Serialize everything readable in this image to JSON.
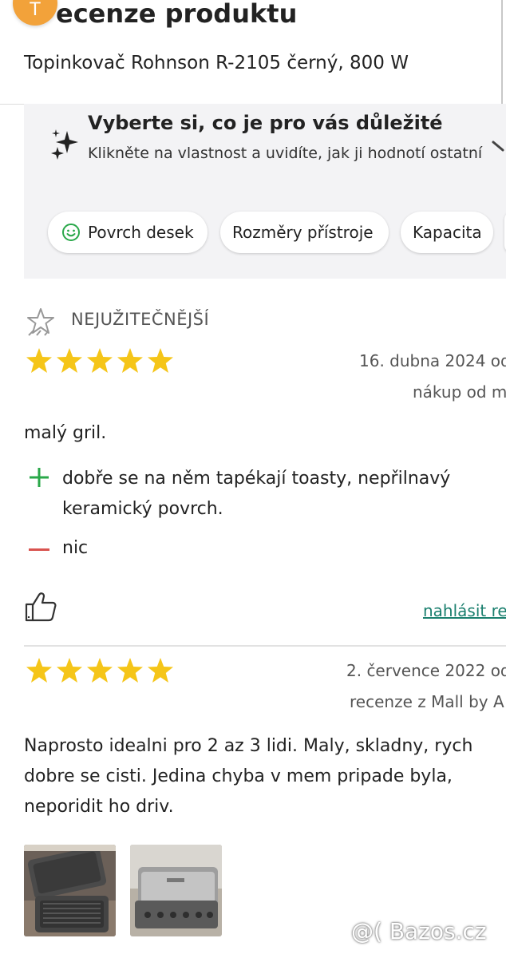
{
  "header": {
    "avatar_initial": "T",
    "title": "ecenze produktu",
    "product": "Topinkovač Rohnson R-2105 černý, 800 W"
  },
  "preferences": {
    "title": "Vyberte si, co je pro vás důležité",
    "description": "Klikněte na vlastnost a uvidíte, jak ji hodnotí ostatní",
    "chips": [
      "Povrch desek",
      "Rozměry přístroje",
      "Kapacita"
    ]
  },
  "reviews": [
    {
      "badge": "NEJUŽITEČNĚJŠÍ",
      "rating": 5,
      "date": "16. dubna 2024 od",
      "source": "nákup od m",
      "text": "malý gril.",
      "pros": "dobře se na něm tapékají toasty, nepřilnavý keramický povrch.",
      "cons": "nic",
      "report": "nahlásit re"
    },
    {
      "rating": 5,
      "date": "2. července 2022 od",
      "source": "recenze z Mall by A",
      "text": "Naprosto idealni pro 2 az 3 lidi. Maly, skladny, rych dobre se cisti. Jedina chyba v mem pripade byla, neporidit ho driv.",
      "photos": [
        "photo-grill-open",
        "photo-grill-closed"
      ]
    }
  ],
  "watermark": "@( Bazos.cz",
  "colors": {
    "star": "#f5c518",
    "accent_green": "#2aa84a",
    "cons_red": "#d9534f",
    "link": "#1a7f6e",
    "panel_bg": "#f3f3f5"
  },
  "icons": [
    "sparkle-icon",
    "chevron-right-icon",
    "smiley-icon",
    "most-useful-icon",
    "star-icon",
    "plus-icon",
    "minus-icon",
    "thumbs-up-icon"
  ]
}
